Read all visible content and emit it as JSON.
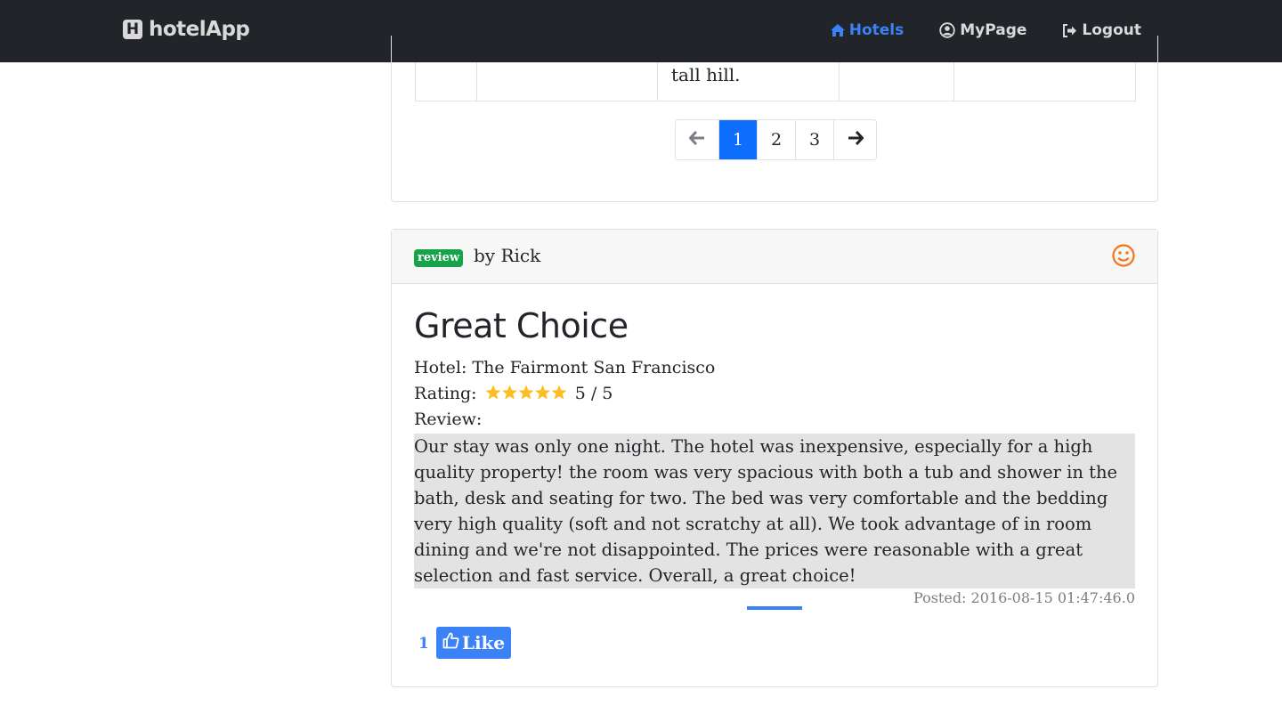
{
  "navbar": {
    "brand": "hotelApp",
    "links": [
      {
        "label": "Hotels",
        "icon": "home-icon",
        "active": true
      },
      {
        "label": "MyPage",
        "icon": "user-circle-icon",
        "active": false
      },
      {
        "label": "Logout",
        "icon": "sign-out-icon",
        "active": false
      }
    ]
  },
  "table": {
    "visible_cell_text": "tall hill."
  },
  "pagination": {
    "prev_icon": "arrow-left-icon",
    "pages": [
      "1",
      "2",
      "3"
    ],
    "current_page": "1",
    "next_icon": "arrow-right-icon"
  },
  "review": {
    "badge": "review",
    "by": "by Rick",
    "mood_icon": "smile-icon",
    "title": "Great Choice",
    "hotel_line": "Hotel: The Fairmont San Francisco",
    "rating_label": "Rating:",
    "rating_value": "5 / 5",
    "rating_stars": 5,
    "review_label": "Review:",
    "body": "Our stay was only one night. The hotel was inexpensive, especially for a high quality property! the room was very spacious with both a tub and shower in the bath, desk and seating for two. The bed was very comfortable and the bedding very high quality (soft and not scratchy at all). We took advantage of in room dining and we're not disappointed. The prices were reasonable with a great selection and fast service. Overall, a great choice!",
    "posted": "Posted: 2016-08-15 01:47:46.0",
    "like_count": "1",
    "like_label": "Like"
  },
  "colors": {
    "navbar_bg": "#212529",
    "accent": "#3b82f6",
    "badge_green": "#16a34a",
    "smile_orange": "#f97316",
    "star_yellow": "#fbbf24"
  }
}
